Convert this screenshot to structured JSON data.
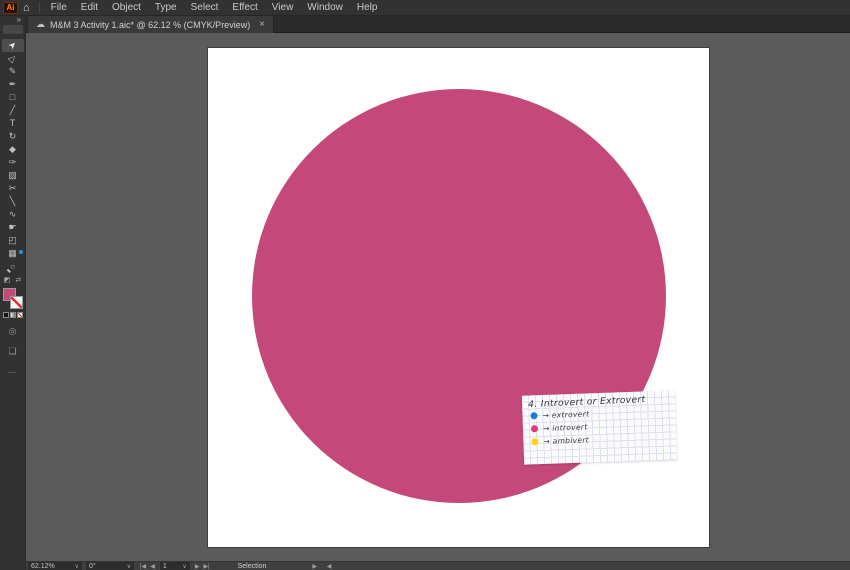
{
  "window": {
    "logo_text": "Ai",
    "home_icon": "⌂"
  },
  "menu": {
    "items": [
      "File",
      "Edit",
      "Object",
      "Type",
      "Select",
      "Effect",
      "View",
      "Window",
      "Help"
    ]
  },
  "tab": {
    "cloud_icon": "☁",
    "title": "M&M 3 Activity 1.aic* @ 62.12 % (CMYK/Preview)",
    "close_icon": "×"
  },
  "toolbar": {
    "collapse_icon": "»",
    "tools": [
      {
        "name": "selection",
        "glyph": "➤"
      },
      {
        "name": "direct-selection",
        "glyph": "▷"
      },
      {
        "name": "paintbrush",
        "glyph": "✎"
      },
      {
        "name": "pen",
        "glyph": "✒"
      },
      {
        "name": "rectangle",
        "glyph": "□"
      },
      {
        "name": "line-segment",
        "glyph": "╱"
      },
      {
        "name": "type",
        "glyph": "T"
      },
      {
        "name": "rotate",
        "glyph": "↻"
      },
      {
        "name": "eraser",
        "glyph": "◆"
      },
      {
        "name": "eyedropper",
        "glyph": "✑"
      },
      {
        "name": "gradient",
        "glyph": "▨"
      },
      {
        "name": "scissors",
        "glyph": "✂"
      },
      {
        "name": "knife",
        "glyph": "╲"
      },
      {
        "name": "shaper",
        "glyph": "∿"
      },
      {
        "name": "hand",
        "glyph": "☛"
      },
      {
        "name": "artboard",
        "glyph": "◰"
      },
      {
        "name": "perspective-grid",
        "glyph": "▦"
      },
      {
        "name": "zoom",
        "glyph": "○"
      }
    ],
    "default_colors_icon": "◩",
    "swap_colors_icon": "⇄",
    "draw_mode_icon": "◎",
    "screen_mode_icon": "❏",
    "edit_toolbar_icon": "…"
  },
  "document": {
    "circle_color": "#C4487A"
  },
  "note": {
    "title": "4. Introvert or Extrovert",
    "legend": [
      {
        "color": "#1B7CD8",
        "label": "→ extrovert"
      },
      {
        "color": "#E13A78",
        "label": "→ introvert"
      },
      {
        "color": "#FFD215",
        "label": "→ ambivert"
      }
    ]
  },
  "colors": {
    "fill_swatch": "#C4487A"
  },
  "statusbar": {
    "zoom_value": "62.12%",
    "rotation_value": "0°",
    "chevron": "∨",
    "nav_first": "|◀",
    "nav_prev": "◀",
    "artboard_number": "1",
    "nav_next": "▶",
    "nav_last": "▶|",
    "status_label": "Selection",
    "scroll_arrows": "▶ ◀"
  }
}
